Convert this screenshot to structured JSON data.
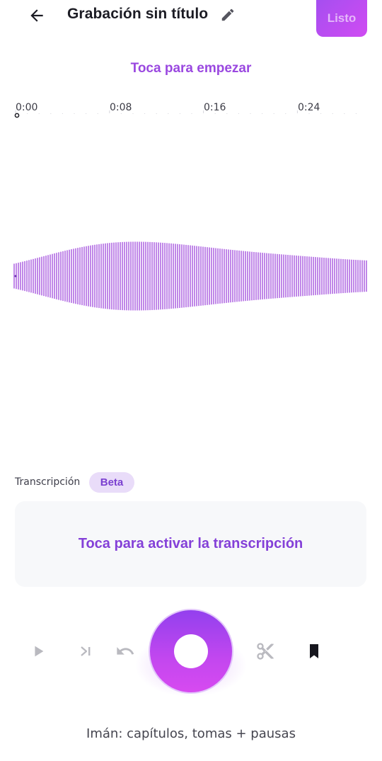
{
  "header": {
    "title": "Grabación sin título",
    "done_label": "Listo",
    "back_icon": "arrow-left-icon",
    "edit_icon": "pencil-icon"
  },
  "prompt": {
    "tap_to_start": "Toca para empezar"
  },
  "timeline": {
    "ticks": [
      "0:00",
      "0:08",
      "0:16",
      "0:24"
    ]
  },
  "transcription": {
    "label": "Transcripción",
    "badge": "Beta",
    "activate_prompt": "Toca para activar la transcripción"
  },
  "controls": {
    "play_icon": "play-icon",
    "skip_icon": "skip-to-end-icon",
    "undo_icon": "undo-icon",
    "record_icon": "record-icon",
    "cut_icon": "scissors-icon",
    "bookmark_icon": "bookmark-icon"
  },
  "footer": {
    "magnet_text": "Imán: capítulos, tomas + pausas"
  },
  "colors": {
    "accent": "#9a48e0",
    "waveform": "#b169e3",
    "record_gradient_top": "#9340ee",
    "record_gradient_bottom": "#d74af0",
    "badge_bg": "#e9dcf9"
  }
}
